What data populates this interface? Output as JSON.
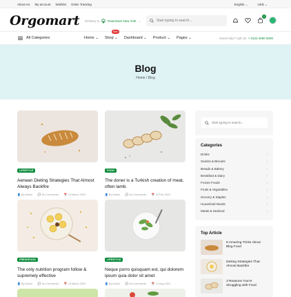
{
  "topbar": {
    "links": [
      "About Us",
      "My account",
      "Wishlist",
      "Order Tracking"
    ],
    "language": "English",
    "currency": "USD"
  },
  "header": {
    "logo": "Orgomart",
    "deliver_label": "Delivery to",
    "deliver_location": "Downtown New York",
    "search_placeholder": "Start typing to search...",
    "cart_count": "0"
  },
  "nav": {
    "all_categories": "All Categories",
    "menu": [
      "Home",
      "Shop",
      "Dashboard",
      "Product",
      "Pages"
    ],
    "new_badge": "New",
    "help_label": "Need help? Call Us:",
    "help_phone": "+ 0123 4000 5000"
  },
  "banner": {
    "title": "Blog",
    "breadcrumb": "Home / Blog"
  },
  "posts": [
    {
      "tag": "LIFESTYLE",
      "title": "Aenean Dieting Strategies That Almost Always Backfire",
      "author": "By Admin",
      "comments": "No Comments",
      "date": "10 March 2020"
    },
    {
      "tag": "FOOD",
      "title": "The doner is a Turkish creation of meat, often lamb.",
      "author": "By Admin",
      "comments": "No Comments",
      "date": "22 Feb 2020"
    },
    {
      "tag": "FRESHFOOD",
      "title": "The only nutrition program follow & supremely effective",
      "author": "By Admin",
      "comments": "No Comments",
      "date": "10 March 2020"
    },
    {
      "tag": "LIFESTYLE",
      "title": "Neque porro quisquam est, qui dolorem ipsum quia dolor sit amet",
      "author": "By Admin",
      "comments": "No Comments",
      "date": "10 Aug 2020"
    }
  ],
  "sidebar": {
    "search_placeholder": "Start typing to search...",
    "categories_title": "Categories",
    "categories": [
      "Drinks",
      "Snacks & Biscuits",
      "Breads & Bakery",
      "Breakfast & Dairy",
      "Frozen Foods",
      "Fruits & Vegetables",
      "Grocery & Staples",
      "Household Needs",
      "Meats & Seafood"
    ],
    "top_title": "Top Article",
    "top_articles": [
      "8 Amazing Tricks About Blog Food",
      "Dieting Strategies That Almost Backfire",
      "3 Reasons You're Struggling with Food"
    ]
  },
  "colors": {
    "accent": "#0a8a3a",
    "banner": "#dff3f5",
    "badge": "#e03131"
  }
}
